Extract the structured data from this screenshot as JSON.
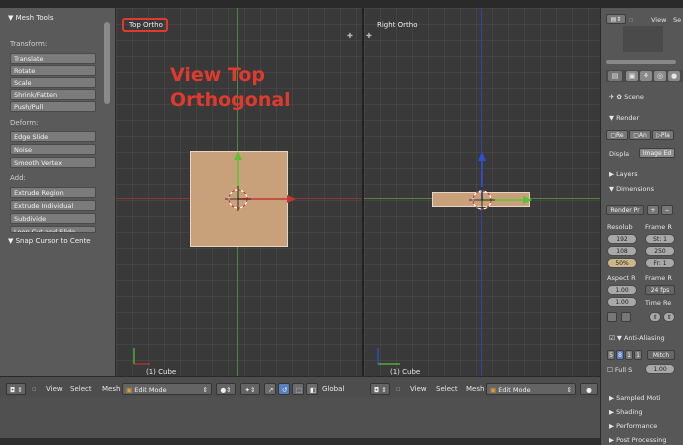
{
  "tool_shelf": {
    "header": "▼ Mesh Tools",
    "transform_label": "Transform:",
    "transform_buttons": [
      "Translate",
      "Rotate",
      "Scale",
      "Shrink/Fatten",
      "Push/Pull"
    ],
    "deform_label": "Deform:",
    "deform_buttons": [
      "Edge Slide",
      "Noise",
      "Smooth Vertex"
    ],
    "add_label": "Add:",
    "add_buttons": [
      "Extrude Region",
      "Extrude Individual",
      "Subdivide",
      "Loop Cut and Slide"
    ],
    "snap_panel": "▼ Snap Cursor to Cente"
  },
  "viewport_left": {
    "title": "Top Ortho",
    "annotation_line1": "View Top",
    "annotation_line2": "Orthogonal",
    "footer": "(1) Cube"
  },
  "viewport_right": {
    "title": "Right Ortho",
    "footer": "(1) Cube"
  },
  "header_left": {
    "view": "View",
    "select": "Select",
    "mesh": "Mesh",
    "mode": "Edit Mode",
    "orientation": "Global"
  },
  "header_right": {
    "view": "View",
    "select": "Select",
    "mesh": "Mesh",
    "mode": "Edit Mode"
  },
  "properties": {
    "top_view": "View",
    "top_se": "Se",
    "scene_label": "Scene",
    "render_panel": "▼ Render",
    "render_btn": "Re",
    "anim_btn": "An",
    "play_btn": "Pla",
    "display_label": "Displa",
    "display_value": "Image Ed",
    "layers_panel": "▶ Layers",
    "dimensions_panel": "▼ Dimensions",
    "render_preset": "Render Pr",
    "resolution_label": "Resolub",
    "frame_range_label": "Frame R",
    "res_x": "192",
    "res_y": "108",
    "res_pct": "50%",
    "start_frame": "St: 1",
    "end_frame": "250",
    "frame_step": "Fr: 1",
    "aspect_label": "Aspect R",
    "frame_rate_label": "Frame R",
    "aspect_x": "1.00",
    "aspect_y": "1.00",
    "fps": "24 fps",
    "time_remap_label": "Time Re",
    "antialias_panel": "▼ Anti-Aliasing",
    "aa_samples": [
      "5",
      "8",
      "1",
      "1"
    ],
    "aa_filter": "Mitch",
    "full_sample": "Full S",
    "filter_size": "1.00",
    "sampled_motion": "▶ Sampled Moti",
    "shading_panel": "▶ Shading",
    "performance_panel": "▶ Performance",
    "post_processing_panel": "▶ Post Processing"
  },
  "colors": {
    "annotation_red": "#e03a2e",
    "cube_fill": "#c8a07a",
    "axis_green": "#5bc236",
    "axis_red": "#c23636",
    "axis_blue": "#2e4fd6"
  }
}
